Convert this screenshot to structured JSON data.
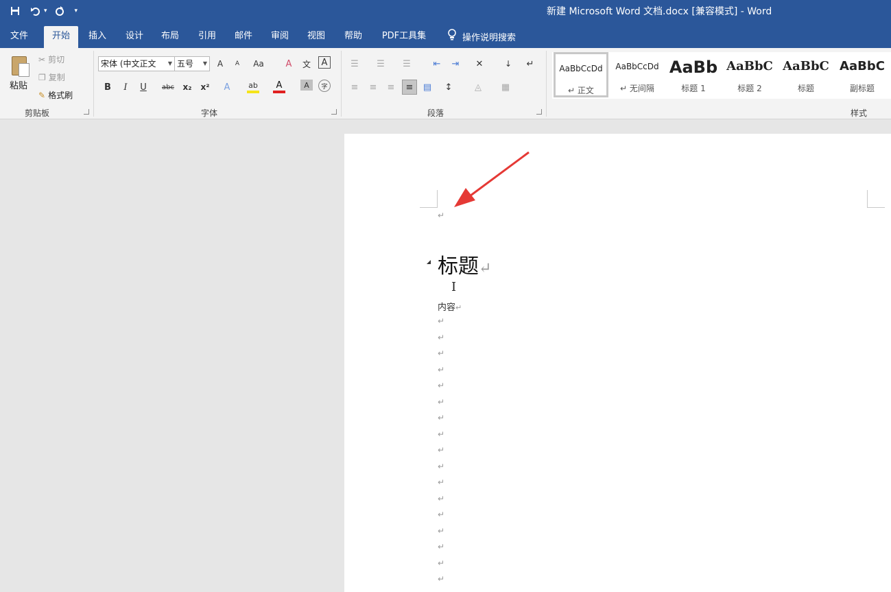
{
  "window": {
    "title": "新建 Microsoft Word 文档.docx [兼容模式]  -  Word",
    "colors": {
      "titlebar": "#2b579a",
      "ribbon": "#f3f3f3",
      "arrow": "#e53935"
    }
  },
  "qat": {
    "save_icon": "save-icon",
    "undo_icon": "undo-icon",
    "redo_icon": "redo-icon",
    "customize_icon": "chevron-down-icon"
  },
  "tabs": [
    {
      "label": "文件"
    },
    {
      "label": "开始"
    },
    {
      "label": "插入"
    },
    {
      "label": "设计"
    },
    {
      "label": "布局"
    },
    {
      "label": "引用"
    },
    {
      "label": "邮件"
    },
    {
      "label": "审阅"
    },
    {
      "label": "视图"
    },
    {
      "label": "帮助"
    },
    {
      "label": "PDF工具集"
    }
  ],
  "active_tab": "开始",
  "tell_me": {
    "label": "操作说明搜索",
    "icon": "lightbulb-icon"
  },
  "clipboard": {
    "paste": "粘贴",
    "cut": "剪切",
    "copy": "复制",
    "format_painter": "格式刷",
    "group": "剪贴板"
  },
  "font": {
    "name": "宋体 (中文正文",
    "size": "五号",
    "grow": "A",
    "shrink": "A",
    "change_case": "Aa",
    "clear_format": "A",
    "phonetic": "文",
    "border": "A",
    "bold": "B",
    "italic": "I",
    "underline": "U",
    "strike": "abc",
    "subscript": "x₂",
    "superscript": "x²",
    "effects": "A",
    "highlight": "ab",
    "font_color": "A",
    "shading": "A",
    "enclose": "字",
    "group": "字体"
  },
  "paragraph": {
    "group": "段落"
  },
  "styles": {
    "group": "样式",
    "items": [
      {
        "sample": "AaBbCcDd",
        "name": "正文"
      },
      {
        "sample": "AaBbCcDd",
        "name": "无间隔"
      },
      {
        "sample": "AaBb",
        "name": "标题 1"
      },
      {
        "sample": "AaBbC",
        "name": "标题 2"
      },
      {
        "sample": "AaBbC",
        "name": "标题"
      },
      {
        "sample": "AaBbC",
        "name": "副标题"
      }
    ]
  },
  "document": {
    "heading": "标题",
    "content": "内容",
    "para_mark": "↵",
    "empty_lines": 17
  }
}
